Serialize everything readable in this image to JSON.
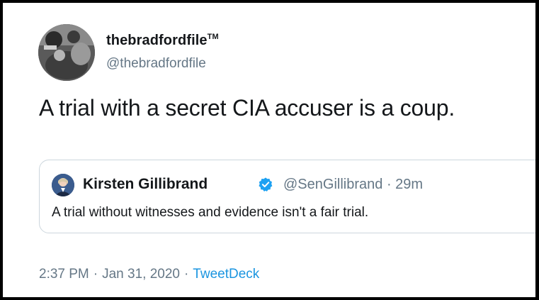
{
  "tweet": {
    "author": {
      "display_name": "thebradfordfile",
      "name_suffix": "TM",
      "handle": "@thebradfordfile"
    },
    "text": "A trial with a secret CIA accuser is a coup.",
    "quoted": {
      "author_name": "Kirsten Gillibrand",
      "verified": true,
      "handle": "@SenGillibrand",
      "separator": "·",
      "time_ago": "29m",
      "text": "A trial without witnesses and evidence isn't a fair trial."
    },
    "footer": {
      "time": "2:37 PM",
      "separator": "·",
      "date": "Jan 31, 2020",
      "source": "TweetDeck"
    }
  },
  "colors": {
    "text_primary": "#14171a",
    "text_secondary": "#657786",
    "link": "#1b95e0",
    "verified": "#1da1f2",
    "border": "#ccd6dd",
    "frame": "#000000"
  }
}
